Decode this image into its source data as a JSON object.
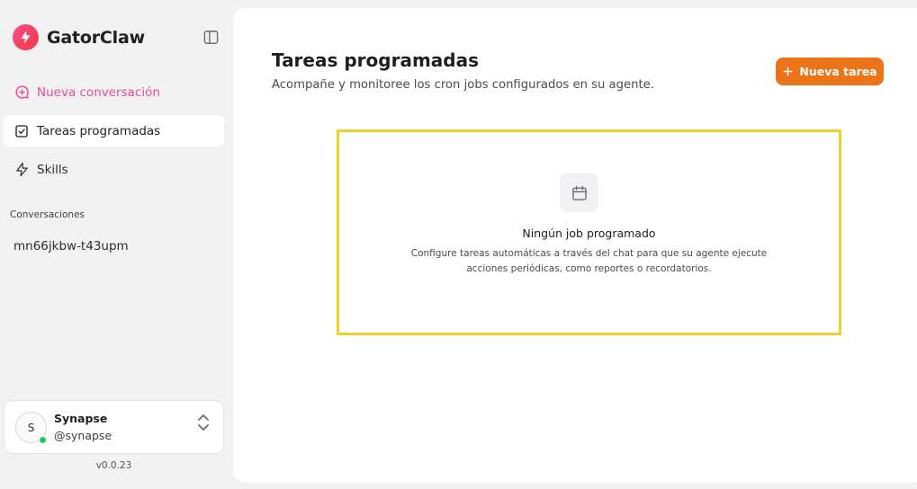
{
  "app": {
    "name": "GatorClaw",
    "version": "v0.0.23",
    "brand_color": "#f43f5e",
    "accent_color": "#ea7417"
  },
  "sidebar": {
    "toggle_icon": "sidebar-toggle-icon",
    "nav": [
      {
        "label": "Nueva conversación",
        "icon": "chat-plus-icon",
        "active": false
      },
      {
        "label": "Tareas programadas",
        "icon": "checkbox-icon",
        "active": true
      },
      {
        "label": "Skills",
        "icon": "lightning-icon",
        "active": false
      }
    ],
    "conversations_label": "Conversaciones",
    "conversations": [
      {
        "label": "mn66jkbw-t43upm"
      }
    ],
    "user": {
      "initial": "S",
      "name": "Synapse",
      "handle": "@synapse",
      "status": "online"
    }
  },
  "main": {
    "title": "Tareas programadas",
    "subtitle": "Acompañe y monitoree los cron jobs configurados en su agente.",
    "new_task_label": "Nueva tarea",
    "empty_state": {
      "icon": "calendar-icon",
      "title": "Ningún job programado",
      "description": "Configure tareas automáticas a través del chat para que su agente ejecute acciones periódicas, como reportes o recordatorios."
    }
  }
}
